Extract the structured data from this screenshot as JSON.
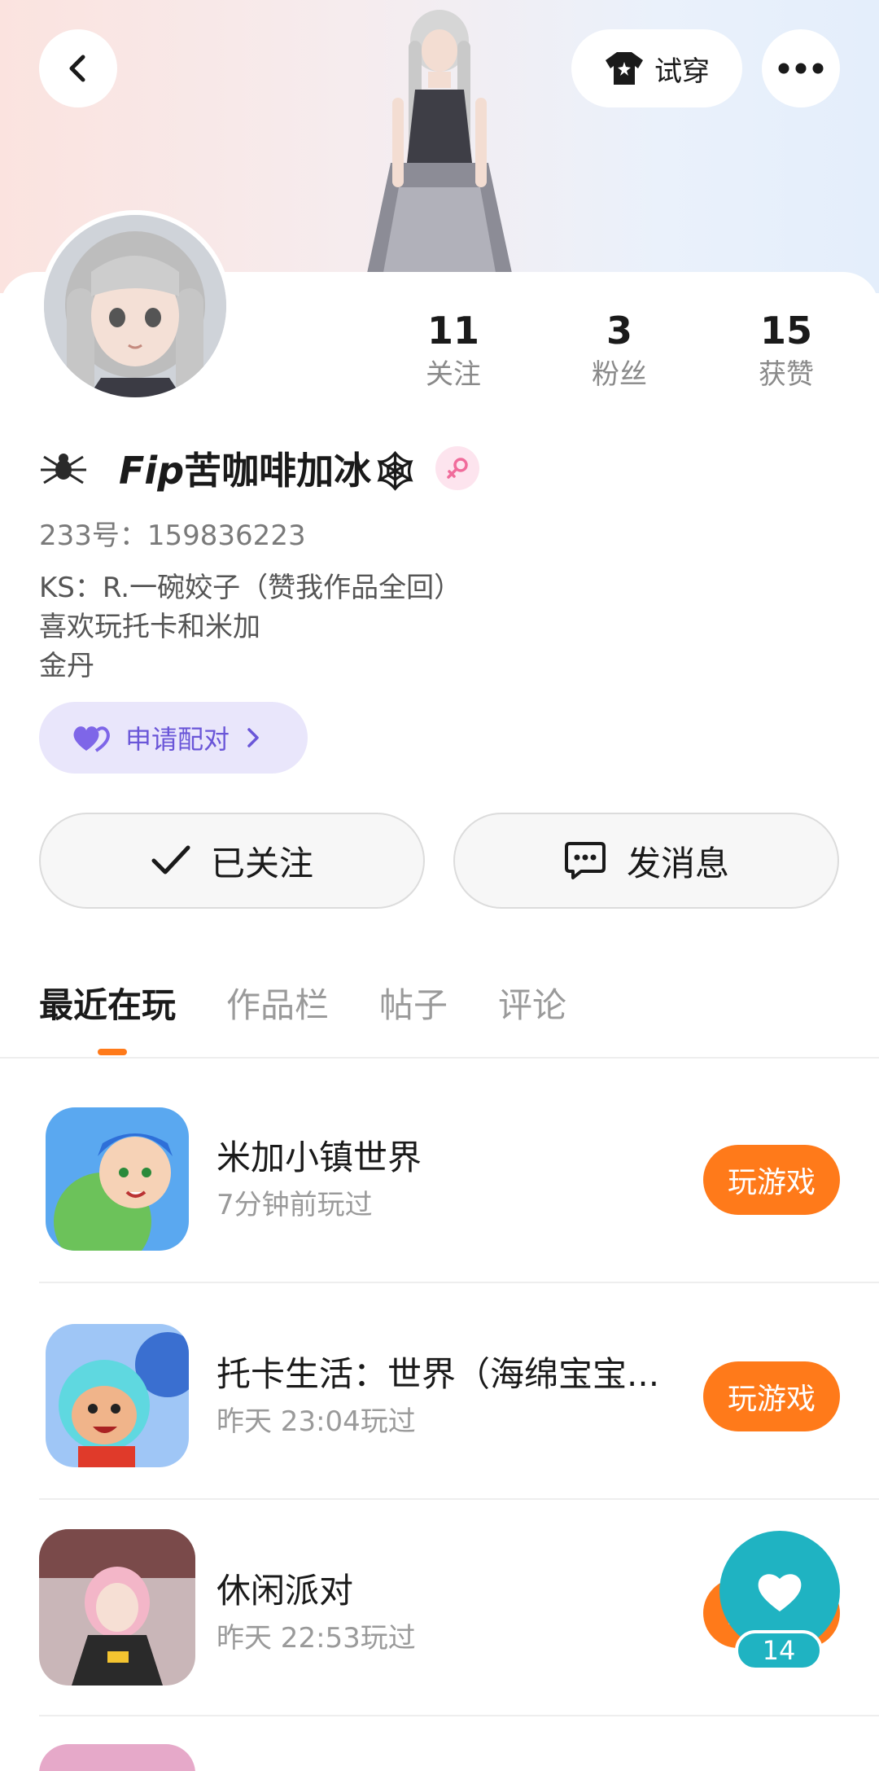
{
  "header": {
    "tryon_label": "试穿"
  },
  "profile": {
    "stats": [
      {
        "value": "11",
        "label": "关注"
      },
      {
        "value": "3",
        "label": "粉丝"
      },
      {
        "value": "15",
        "label": "获赞"
      }
    ],
    "name_prefix": "Fip",
    "name_rest": "苦咖啡加冰🕸",
    "id_line": "233号：159836223",
    "bio_lines": [
      "KS：R.一碗姣子（赞我作品全回）",
      "喜欢玩托卡和米加",
      "金丹"
    ],
    "pair_label": "申请配对",
    "follow_label": "已关注",
    "message_label": "发消息"
  },
  "tabs": [
    "最近在玩",
    "作品栏",
    "帖子",
    "评论"
  ],
  "games": [
    {
      "title": "米加小镇世界",
      "time": "7分钟前玩过",
      "button": "玩游戏"
    },
    {
      "title": "托卡生活：世界（海绵宝宝...",
      "time": "昨天 23:04玩过",
      "button": "玩游戏"
    },
    {
      "title": "休闲派对",
      "time": "昨天 22:53玩过",
      "button": "玩游戏"
    }
  ],
  "like": {
    "count": "14"
  },
  "colors": {
    "accent": "#ff7a1a",
    "pair_bg": "#e9e6fb",
    "pair_text": "#6a56d8",
    "like_bg": "#1fb3c2"
  }
}
